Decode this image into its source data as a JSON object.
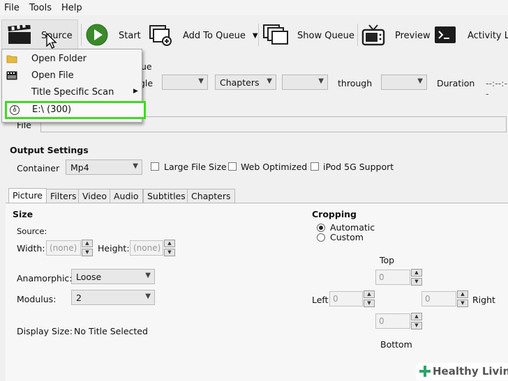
{
  "menubar": {
    "items": [
      "File",
      "Tools",
      "Help"
    ]
  },
  "toolbar": {
    "source": "Source",
    "start": "Start",
    "add_to_queue": "Add To Queue",
    "show_queue": "Show Queue",
    "preview": "Preview",
    "activity_log": "Activity Lo"
  },
  "source_menu": {
    "open_folder": "Open Folder",
    "open_file": "Open File",
    "title_specific_scan": "Title Specific Scan",
    "drive": "E:\\ (300)",
    "highlight_color": "#3ddc1e"
  },
  "source_row": {
    "peek_text": "ue",
    "angle_label": "gle",
    "chapters_select": "Chapters",
    "through": "through",
    "duration_label": "Duration",
    "duration_value": "--:--:--"
  },
  "destination": {
    "file_label": "File"
  },
  "output_settings": {
    "title": "Output Settings",
    "container_label": "Container",
    "container_value": "Mp4",
    "large_file_size": "Large File Size",
    "web_optimized": "Web Optimized",
    "ipod": "iPod 5G Support"
  },
  "tabs": [
    "Picture",
    "Filters",
    "Video",
    "Audio",
    "Subtitles",
    "Chapters"
  ],
  "picture": {
    "size_title": "Size",
    "source_label": "Source:",
    "width_label": "Width:",
    "width_value": "(none)",
    "height_label": "Height:",
    "height_value": "(none)",
    "anamorphic_label": "Anamorphic:",
    "anamorphic_value": "Loose",
    "modulus_label": "Modulus:",
    "modulus_value": "2",
    "display_size_label": "Display Size:",
    "display_size_value": "No Title Selected"
  },
  "cropping": {
    "title": "Cropping",
    "automatic": "Automatic",
    "custom": "Custom",
    "top_label": "Top",
    "top_value": "0",
    "left_label": "Left",
    "left_value": "0",
    "right_label": "Right",
    "right_value": "0",
    "bottom_label": "Bottom",
    "bottom_value": "0"
  },
  "watermark": {
    "text": "Healthy Living"
  }
}
